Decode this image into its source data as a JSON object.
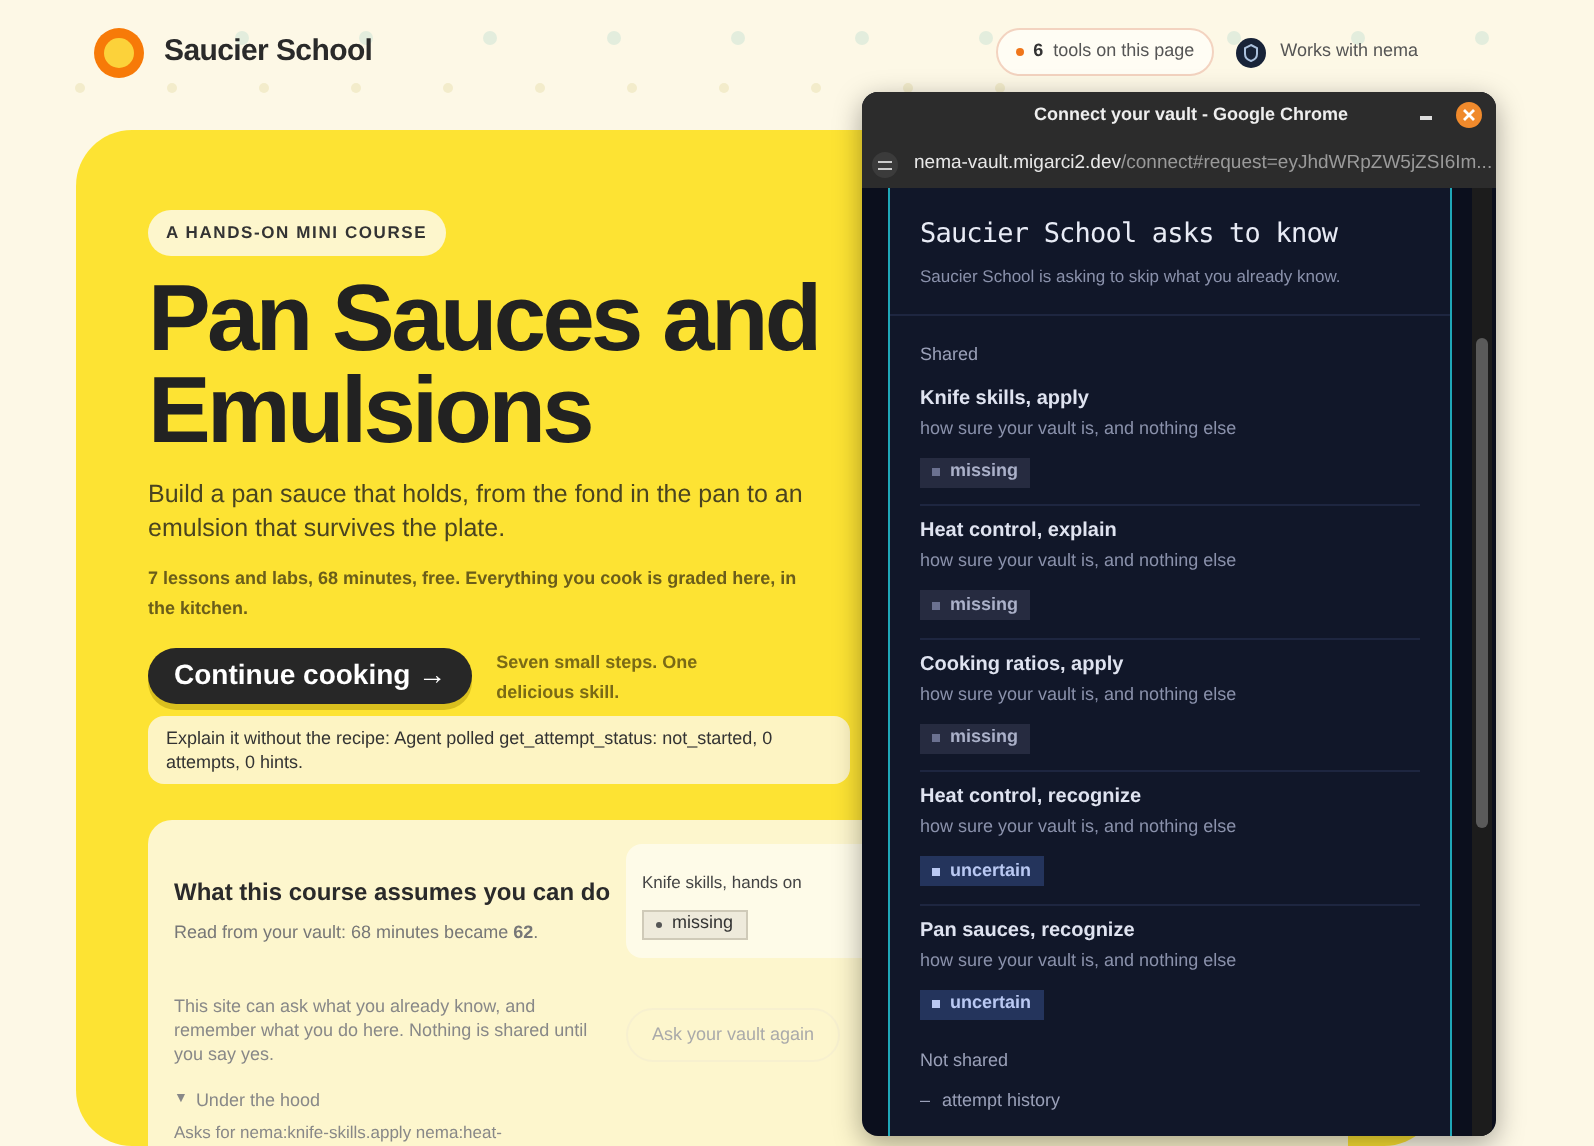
{
  "site": {
    "name": "Saucier School",
    "tools_badge": {
      "count": "6",
      "label": "tools on this page"
    },
    "works_with": "Works with nema"
  },
  "hero": {
    "eyebrow": "A HANDS-ON MINI COURSE",
    "title": "Pan Sauces and Emulsions",
    "lead": "Build a pan sauce that holds, from the fond in the pan to an emulsion that survives the plate.",
    "meta": "7 lessons and labs, 68 minutes, free. Everything you cook is graded here, in the kitchen.",
    "cta": "Continue cooking →",
    "cta_note": "Seven small steps. One delicious skill.",
    "agent_note": "Explain it without the recipe: Agent polled get_attempt_status: not_started, 0 attempts, 0 hints."
  },
  "assumes": {
    "title": "What this course assumes you can do",
    "subtitle": "Read from your vault: 68 minutes became **62**.",
    "skill": {
      "label": "Knife skills, hands on",
      "status": "missing"
    },
    "consent": "This site can ask what you already know, and remember what you do here. Nothing is shared until you say yes.",
    "ask_button": "Ask your vault again",
    "under_hood": {
      "marker": "▼",
      "label": "Under the hood",
      "expanded": true
    },
    "asks_for": "Asks for nema:knife-skills.apply nema:heat-"
  },
  "popup": {
    "window_title": "Connect your vault - Google Chrome",
    "url_host": "nema-vault.migarci2.dev",
    "url_rest": "/connect#request=eyJhdWRpZW5jZSI6Im...",
    "heading": "Saucier School asks to know",
    "subheading": "Saucier School is asking to skip what you already know.",
    "shared_label": "Shared",
    "items": [
      {
        "title": "Knife skills, apply",
        "note": "how sure your vault is, and nothing else",
        "status": "missing"
      },
      {
        "title": "Heat control, explain",
        "note": "how sure your vault is, and nothing else",
        "status": "missing"
      },
      {
        "title": "Cooking ratios, apply",
        "note": "how sure your vault is, and nothing else",
        "status": "missing"
      },
      {
        "title": "Heat control, recognize",
        "note": "how sure your vault is, and nothing else",
        "status": "uncertain"
      },
      {
        "title": "Pan sauces, recognize",
        "note": "how sure your vault is, and nothing else",
        "status": "uncertain"
      }
    ],
    "not_shared_label": "Not shared",
    "not_shared": [
      {
        "marker": "–",
        "text": "attempt history"
      }
    ]
  }
}
